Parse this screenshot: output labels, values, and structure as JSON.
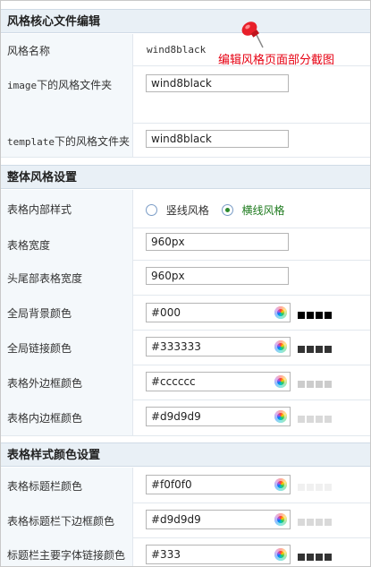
{
  "core_section": {
    "title": "风格核心文件编辑",
    "style_name": {
      "label": "风格名称",
      "value": "wind8black"
    },
    "image_folder": {
      "label_prefix": "image",
      "label_suffix": "下的风格文件夹",
      "value": "wind8black"
    },
    "template_folder": {
      "label_prefix": "template",
      "label_suffix": "下的风格文件夹",
      "value": "wind8black"
    }
  },
  "annotation": {
    "text": "编辑风格页面部分截图",
    "icon": "pushpin-icon"
  },
  "overall_section": {
    "title": "整体风格设置",
    "inner_style": {
      "label": "表格内部样式",
      "option1": "竖线风格",
      "option2": "横线风格",
      "selected": "option2"
    },
    "table_width": {
      "label": "表格宽度",
      "value": "960px"
    },
    "header_footer_width": {
      "label": "头尾部表格宽度",
      "value": "960px"
    },
    "global_bg_color": {
      "label": "全局背景颜色",
      "value": "#000",
      "swatch": "#000000"
    },
    "global_link_color": {
      "label": "全局链接颜色",
      "value": "#333333",
      "swatch": "#333333"
    },
    "table_outer_border": {
      "label": "表格外边框颜色",
      "value": "#cccccc",
      "swatch": "#cccccc"
    },
    "table_inner_border": {
      "label": "表格内边框颜色",
      "value": "#d9d9d9",
      "swatch": "#d9d9d9"
    }
  },
  "table_color_section": {
    "title": "表格样式颜色设置",
    "title_bar_color": {
      "label": "表格标题栏颜色",
      "value": "#f0f0f0",
      "swatch": "#f0f0f0"
    },
    "title_bar_bottom_border": {
      "label": "表格标题栏下边框颜色",
      "value": "#d9d9d9",
      "swatch": "#d9d9d9"
    },
    "title_bar_font_link": {
      "label": "标题栏主要字体链接颜色",
      "value": "#333",
      "swatch": "#333333"
    }
  },
  "colors": {
    "header_bg": "#e9f0f6",
    "label_bg": "#f4f8fb",
    "accent_red": "#e60012",
    "radio_green": "#2d8a2d"
  }
}
